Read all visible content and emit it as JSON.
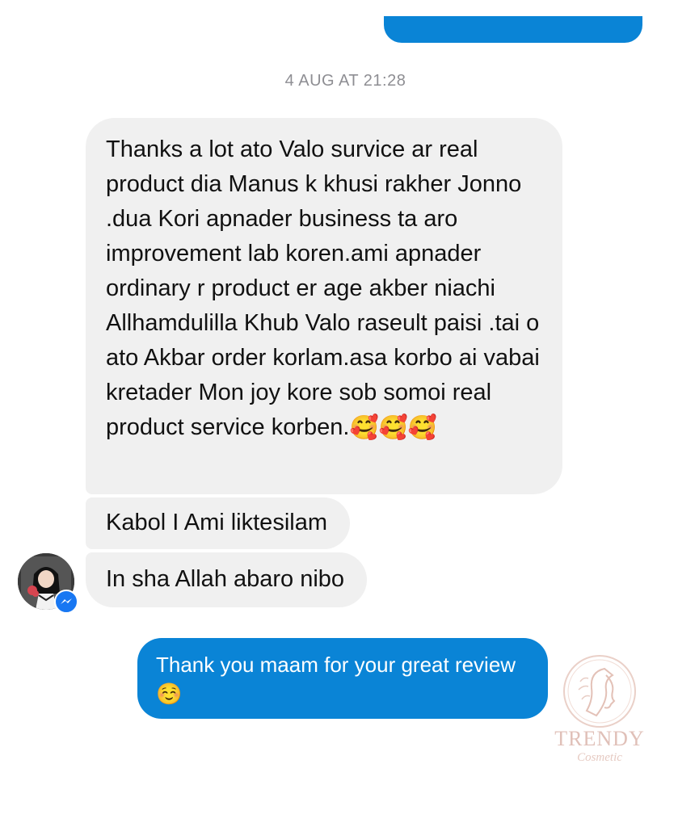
{
  "conversation": {
    "timestamp": "4 AUG AT 21:28",
    "incoming": [
      {
        "text": "Thanks a lot ato Valo survice ar real product dia Manus k khusi rakher Jonno .dua Kori apnader business ta aro improvement lab koren.ami apnader ordinary r product er age akber niachi Allhamdulilla Khub Valo raseult paisi .tai o ato Akbar order korlam.asa korbo ai vabai kretader Mon joy kore sob somoi real product service korben.",
        "emoji": "🥰🥰🥰"
      },
      {
        "text": "Kabol I Ami liktesilam"
      },
      {
        "text": "In sha Allah abaro nibo"
      }
    ],
    "outgoing": [
      {
        "text": "Thank you maam for your great review",
        "emoji": "☺️"
      }
    ]
  },
  "contact": {
    "avatar_icon": "profile-avatar",
    "badge_icon": "messenger-badge-icon"
  },
  "watermark": {
    "brand": "TRENDY",
    "subtitle": "Cosmetic"
  },
  "colors": {
    "outgoing_bubble": "#0a84d6",
    "incoming_bubble": "#f0f0f0",
    "timestamp": "#8e8e93",
    "messenger_badge": "#1877f2"
  }
}
